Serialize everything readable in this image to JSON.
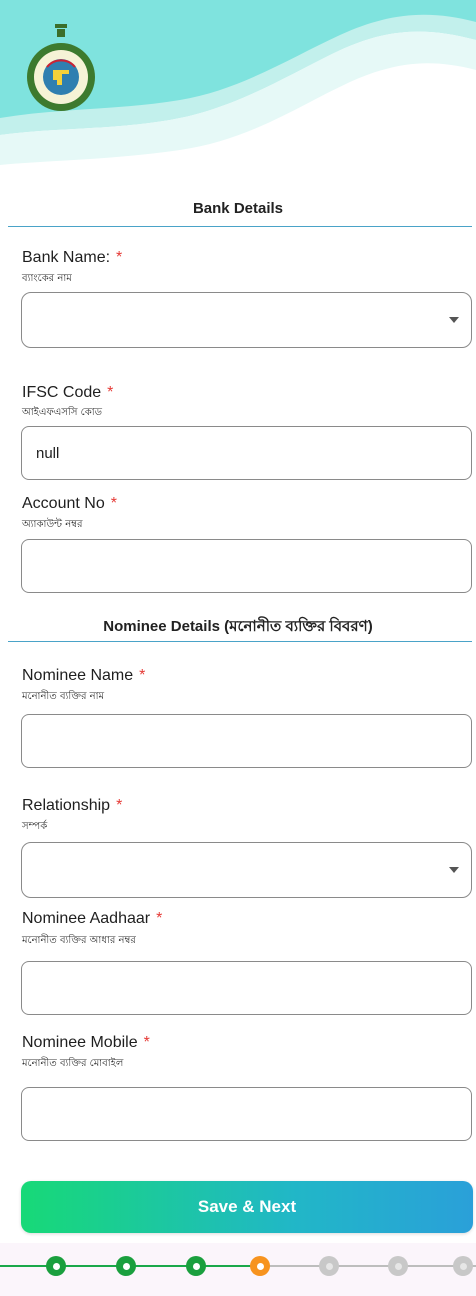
{
  "header": {
    "logo_icon": "west-bengal-emblem-icon",
    "brand_colors": [
      "#7fe3de",
      "#c2f0ec"
    ]
  },
  "bank_section": {
    "title": "Bank Details"
  },
  "fields": {
    "bank_name": {
      "label": "Bank Name:",
      "sub": "ব্যাংকের নাম",
      "value": "",
      "type": "select"
    },
    "ifsc": {
      "label": "IFSC Code",
      "sub": "আইএফএসসি কোড",
      "value": "null"
    },
    "account_no": {
      "label": "Account No",
      "sub": "অ্যাকাউন্ট নম্বর",
      "value": ""
    },
    "nominee_name": {
      "label": "Nominee Name",
      "sub": "মনোনীত ব্যক্তির নাম",
      "value": ""
    },
    "relationship": {
      "label": "Relationship",
      "sub": "সম্পর্ক",
      "value": "",
      "type": "select"
    },
    "nominee_aadhaar": {
      "label": "Nominee Aadhaar",
      "sub": "মনোনীত ব্যক্তির আধার নম্বর",
      "value": ""
    },
    "nominee_mobile": {
      "label": "Nominee Mobile",
      "sub": "মনোনীত ব্যক্তির মোবাইল",
      "value": ""
    }
  },
  "required_mark": "*",
  "nominee_section": {
    "title": "Nominee Details (মনোনীত ব্যক্তির বিবরণ)"
  },
  "actions": {
    "save_label": "Save & Next"
  },
  "stepper": {
    "steps": [
      "done",
      "done",
      "done",
      "current",
      "pending",
      "pending",
      "pending"
    ],
    "colors": {
      "done": "#1a9f3e",
      "current": "#f7931e",
      "pending": "#c8c8c8"
    }
  }
}
